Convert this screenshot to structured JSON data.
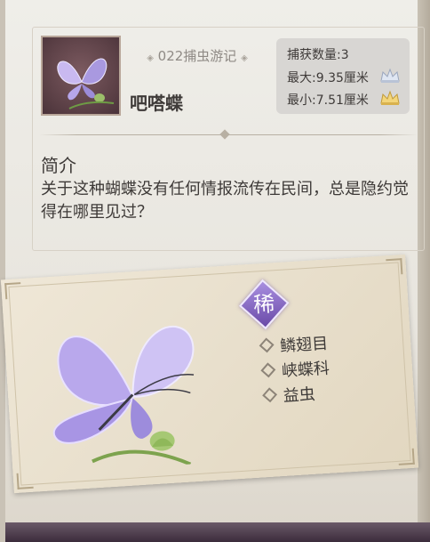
{
  "header": {
    "series_label": "022捕虫游记",
    "creature_name": "吧嗒蝶"
  },
  "stats": {
    "catch_count": "捕获数量:3",
    "max_size": "最大:9.35厘米",
    "min_size": "最小:7.51厘米",
    "max_crown_icon": "silver-crown",
    "min_crown_icon": "gold-crown"
  },
  "intro": {
    "title": "简介",
    "text": "关于这种蝴蝶没有任何情报流传在民间，总是隐约觉得在哪里见过？"
  },
  "card": {
    "rarity_char": "稀",
    "taxonomy": [
      "鳞翅目",
      "峡蝶科",
      "益虫"
    ]
  },
  "colors": {
    "rarity_purple": "#7a5bbd",
    "text_dark": "#3e3a38",
    "stats_bg": "#d8d6d3"
  }
}
